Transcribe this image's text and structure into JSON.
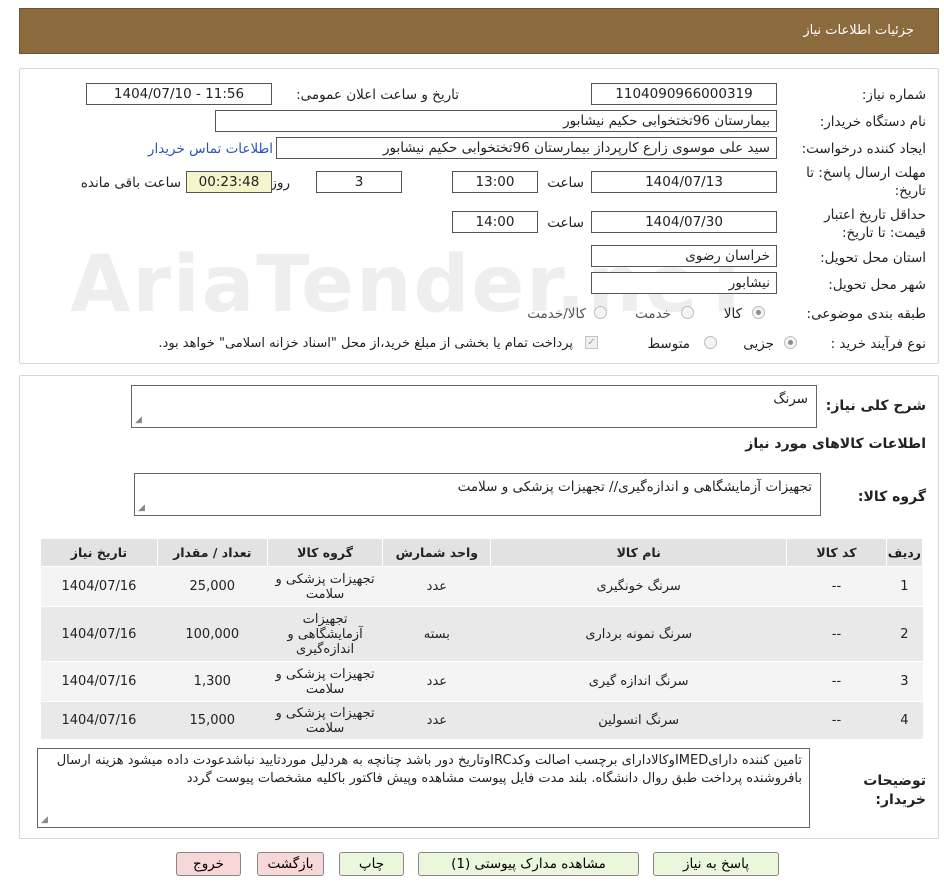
{
  "header": {
    "title": "جزئیات اطلاعات نیاز"
  },
  "watermark": "AriaTender.neT",
  "info": {
    "need_number_label": "شماره نیاز:",
    "need_number": "1104090966000319",
    "announce_label": "تاریخ و ساعت اعلان عمومی:",
    "announce_value": "1404/07/10 - 11:56",
    "buyer_label": "نام دستگاه خریدار:",
    "buyer_value": "بیمارستان 96تختخوابی حکیم نیشابور",
    "creator_label": "ایجاد کننده درخواست:",
    "creator_value": "سید علی  موسوی زارع کارپرداز بیمارستان 96تختخوابی حکیم نیشابور",
    "contact_link": "اطلاعات تماس خریدار",
    "deadline_label_1": "مهلت ارسال پاسخ: تا",
    "deadline_label_2": "تاریخ:",
    "deadline_date": "1404/07/13",
    "time_label": "ساعت",
    "deadline_time": "13:00",
    "days_value": "3",
    "days_label": "روز و",
    "remaining_time": "00:23:48",
    "remaining_label": "ساعت باقی مانده",
    "validity_label_1": "حداقل تاریخ اعتبار",
    "validity_label_2": "قیمت: تا تاریخ:",
    "validity_date": "1404/07/30",
    "validity_time": "14:00",
    "province_label": "استان محل تحویل:",
    "province_value": "خراسان رضوی",
    "city_label": "شهر محل تحویل:",
    "city_value": "نیشابور",
    "category_label": "طبقه بندی موضوعی:",
    "category_options": [
      "کالا",
      "خدمت",
      "کالا/خدمت"
    ],
    "category_selected": "کالا",
    "process_label": "نوع فرآیند خرید :",
    "process_options": [
      "جزیی",
      "متوسط"
    ],
    "process_selected": "جزیی",
    "payment_note": "پرداخت تمام یا بخشی از مبلغ خرید،از محل \"اسناد خزانه اسلامی\" خواهد بود."
  },
  "summary": {
    "description_label": "شرح کلی نیاز:",
    "description_value": "سرنگ",
    "items_section_title": "اطلاعات کالاهای مورد نیاز",
    "group_label": "گروه کالا:",
    "group_value": "تجهیزات آزمایشگاهی و اندازه‌گیری// تجهیزات پزشکی و سلامت",
    "table": {
      "headers": [
        "ردیف",
        "کد کالا",
        "نام کالا",
        "واحد شمارش",
        "گروه کالا",
        "تعداد / مقدار",
        "تاریخ نیاز"
      ],
      "rows": [
        [
          "1",
          "--",
          "سرنگ خونگیری",
          "عدد",
          "تجهیزات پزشکی و سلامت",
          "25,000",
          "1404/07/16"
        ],
        [
          "2",
          "--",
          "سرنگ نمونه برداری",
          "بسته",
          "تجهیزات آزمایشگاهی و اندازه‌گیری",
          "100,000",
          "1404/07/16"
        ],
        [
          "3",
          "--",
          "سرنگ اندازه گیری",
          "عدد",
          "تجهیزات پزشکی و سلامت",
          "1,300",
          "1404/07/16"
        ],
        [
          "4",
          "--",
          "سرنگ انسولین",
          "عدد",
          "تجهیزات پزشکی و سلامت",
          "15,000",
          "1404/07/16"
        ]
      ]
    },
    "notes_label_1": "توضیحات",
    "notes_label_2": "خریدار:",
    "notes_value": "تامین کننده دارایIMEDوکالادارای برچسب اصالت وکدIRCوتاریخ دور باشد چنانچه به هردلیل موردتایید نباشدعودت داده میشود هزینه ارسال بافروشنده پرداخت طبق روال دانشگاه. بلند مدت فایل پیوست مشاهده وپیش فاکتور باکلیه مشخصات پیوست گردد"
  },
  "buttons": {
    "reply": "پاسخ به نیاز",
    "attachments": "مشاهده مدارک پیوستی (1)",
    "print": "چاپ",
    "back": "بازگشت",
    "exit": "خروج"
  }
}
